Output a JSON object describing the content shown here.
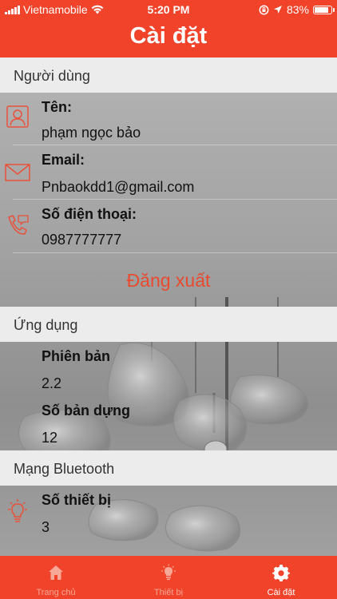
{
  "status_bar": {
    "carrier": "Vietnamobile",
    "time": "5:20 PM",
    "battery": "83%"
  },
  "nav": {
    "title": "Cài đặt"
  },
  "sections": {
    "user": {
      "header": "Người dùng",
      "name_label": "Tên:",
      "name_value": "phạm ngọc bảo",
      "email_label": "Email:",
      "email_value": "Pnbaokdd1@gmail.com",
      "phone_label": "Số điện thoại:",
      "phone_value": "0987777777",
      "logout_label": "Đăng xuất"
    },
    "app": {
      "header": "Ứng dụng",
      "version_label": "Phiên bản",
      "version_value": "2.2",
      "build_label": "Số bản dựng",
      "build_value": "12"
    },
    "bluetooth": {
      "header": "Mạng Bluetooth",
      "devices_label": "Số thiết bị",
      "devices_value": "3"
    }
  },
  "tabs": [
    {
      "label": "Trang chủ",
      "icon": "home-icon",
      "active": false
    },
    {
      "label": "Thiết bị",
      "icon": "lightbulb-icon",
      "active": false
    },
    {
      "label": "Cài đặt",
      "icon": "gear-icon",
      "active": true
    }
  ],
  "colors": {
    "brand": "#f0432a",
    "section_header_bg": "#ececed",
    "logout": "#e84a2e"
  }
}
